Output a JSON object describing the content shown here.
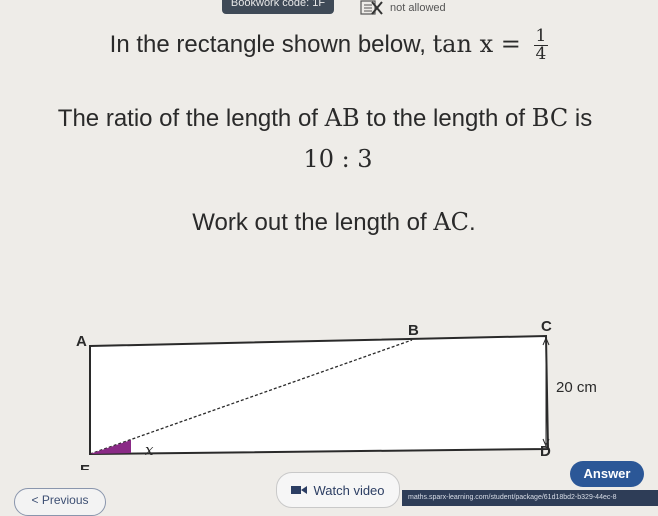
{
  "header": {
    "bookwork_code": "Bookwork code: 1F",
    "calculator_status": "not allowed",
    "calculator_icon": "calculator-crossed-icon"
  },
  "question": {
    "line1_text": "In the rectangle shown below, ",
    "line1_math_lhs": "tan x =",
    "line1_fraction_num": "1",
    "line1_fraction_den": "4",
    "line2_part1": "The ratio of the length of ",
    "line2_ab": "AB",
    "line2_part2": " to the length of ",
    "line2_bc": "BC",
    "line2_part3": " is",
    "line3_ratio": "10 : 3",
    "line4_part1": "Work out the length of ",
    "line4_ac": "AC",
    "line4_part2": "."
  },
  "diagram": {
    "label_a": "A",
    "label_b": "B",
    "label_c": "C",
    "label_d": "D",
    "label_e": "E",
    "angle_label": "x",
    "side_length": "20 cm",
    "angle_fill_color": "#8a2a86"
  },
  "controls": {
    "watch_video": "Watch video",
    "answer": "Answer",
    "previous": "< Previous"
  },
  "url_bar": {
    "text": "maths.sparx-learning.com/student/package/61d18bd2-b329-44ec-8"
  }
}
